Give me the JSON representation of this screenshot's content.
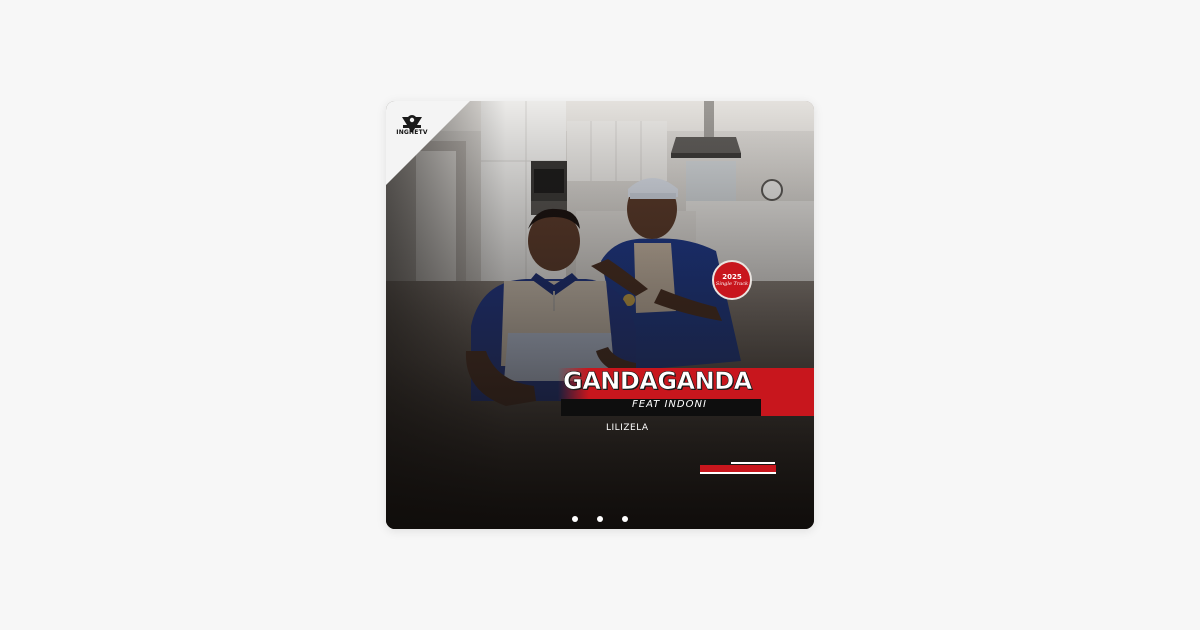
{
  "artwork": {
    "label_logo": "INGHETV",
    "badge": {
      "year": "2025",
      "subtitle": "Single Track"
    },
    "artist": "GANDAGANDA",
    "featuring": "FEAT INDONI",
    "song_title": "LILIZELA"
  },
  "carousel": {
    "dots": 3
  },
  "colors": {
    "page_background": "#f7f7f7",
    "accent_red": "#c8161d",
    "bar_black": "#0e0e0e"
  },
  "icons": {
    "logo": "lion-emblem-icon",
    "dots": "page-indicator-dot"
  }
}
